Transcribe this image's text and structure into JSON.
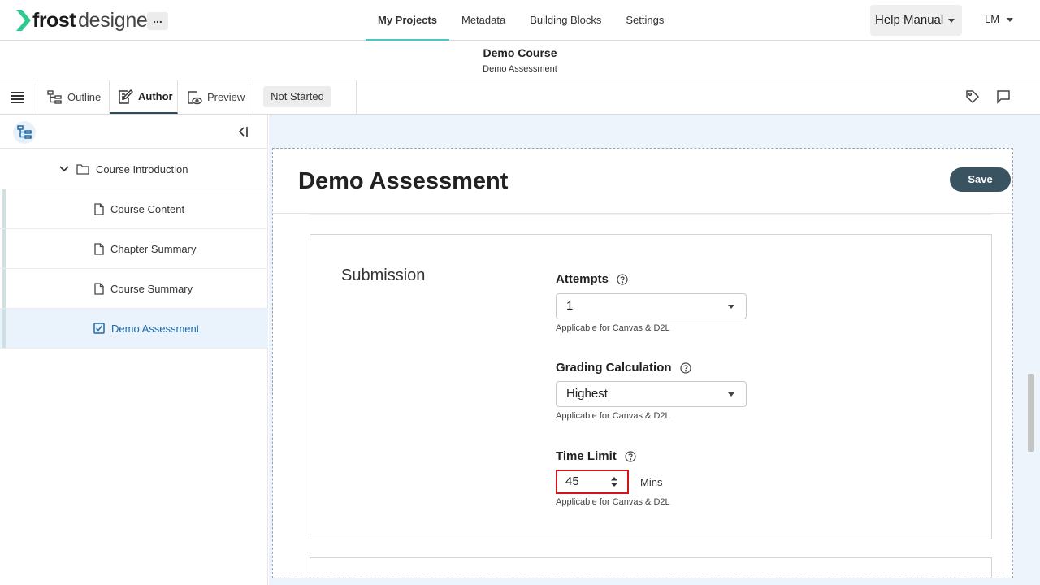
{
  "app": {
    "logo_frost": "frost",
    "logo_designer": "designer",
    "more_label": "...",
    "nav": [
      "My Projects",
      "Metadata",
      "Building Blocks",
      "Settings"
    ],
    "help_label": "Help Manual",
    "user_initials": "LM"
  },
  "course": {
    "title": "Demo Course",
    "subtitle": "Demo Assessment"
  },
  "toolbar": {
    "tabs": [
      "Outline",
      "Author",
      "Preview"
    ],
    "active_tab": "Author",
    "status": "Not Started"
  },
  "sidebar": {
    "folder": "Course Introduction",
    "items": [
      "Course Content",
      "Chapter Summary",
      "Course Summary",
      "Demo Assessment"
    ],
    "selected": "Demo Assessment"
  },
  "editor": {
    "title": "Demo Assessment",
    "save_label": "Save",
    "section_title": "Submission",
    "attempts_label": "Attempts",
    "attempts_value": "1",
    "attempts_hint": "Applicable for Canvas & D2L",
    "grading_label": "Grading Calculation",
    "grading_value": "Highest",
    "grading_hint": "Applicable for Canvas & D2L",
    "time_label": "Time Limit",
    "time_value": "45",
    "time_unit": "Mins",
    "time_hint": "Applicable for Canvas & D2L"
  },
  "icons": {
    "logo": "chevron-right-logo-icon",
    "menu": "hamburger-menu-icon",
    "outline": "tree-outline-icon",
    "author": "edit-document-icon",
    "preview": "eye-preview-icon",
    "tag": "tag-icon",
    "comment": "comment-icon",
    "help": "question-circle-icon"
  },
  "colors": {
    "brand_accent": "#49c6c6",
    "save_button": "#3a5361",
    "selected_item": "#1f6aa8",
    "highlight_border": "#d4141c"
  }
}
